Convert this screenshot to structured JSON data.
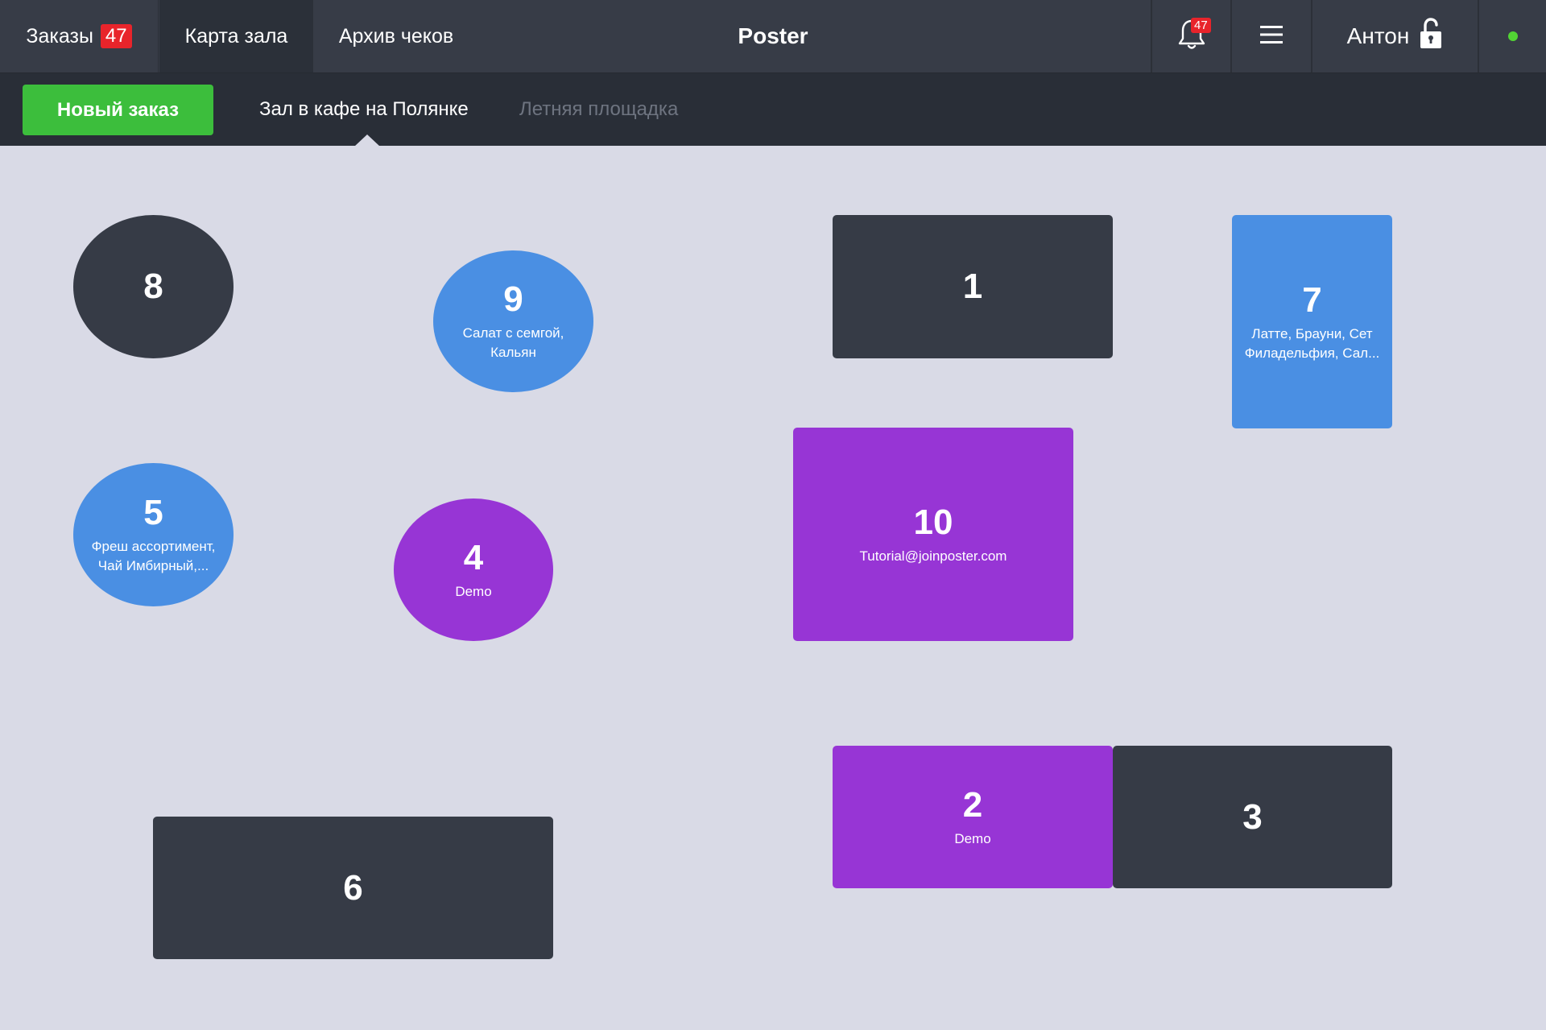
{
  "topbar": {
    "tabs": {
      "orders": {
        "label": "Заказы",
        "badge": "47"
      },
      "map": {
        "label": "Карта зала"
      },
      "archive": {
        "label": "Архив чеков"
      }
    },
    "title": "Poster",
    "notifications_badge": "47",
    "user_name": "Антон",
    "status_color": "#52d434"
  },
  "subbar": {
    "new_order_label": "Новый заказ",
    "halls": [
      {
        "label": "Зал в кафе на Полянке",
        "active": true
      },
      {
        "label": "Летняя площадка",
        "active": false
      }
    ]
  },
  "colors": {
    "free_table": "#363b46",
    "open_order": "#4a8fe3",
    "other_waiter": "#9735d5",
    "new_order_button": "#3cbe3c",
    "badge": "#e8242b"
  },
  "tables": [
    {
      "number": "8",
      "status": "free",
      "items": ""
    },
    {
      "number": "9",
      "status": "open",
      "items_lines": [
        "Салат с семгой,",
        "Кальян"
      ]
    },
    {
      "number": "1",
      "status": "free",
      "items": ""
    },
    {
      "number": "7",
      "status": "open",
      "items_lines": [
        "Латте, Брауни, Сет",
        "Филадельфия, Сал..."
      ]
    },
    {
      "number": "5",
      "status": "open",
      "items_lines": [
        "Фреш ассортимент,",
        "Чай Имбирный,..."
      ]
    },
    {
      "number": "4",
      "status": "other",
      "items": "Demo"
    },
    {
      "number": "10",
      "status": "other",
      "items": "Tutorial@joinposter.com"
    },
    {
      "number": "2",
      "status": "other",
      "items": "Demo"
    },
    {
      "number": "3",
      "status": "free",
      "items": ""
    },
    {
      "number": "6",
      "status": "free",
      "items": ""
    }
  ]
}
